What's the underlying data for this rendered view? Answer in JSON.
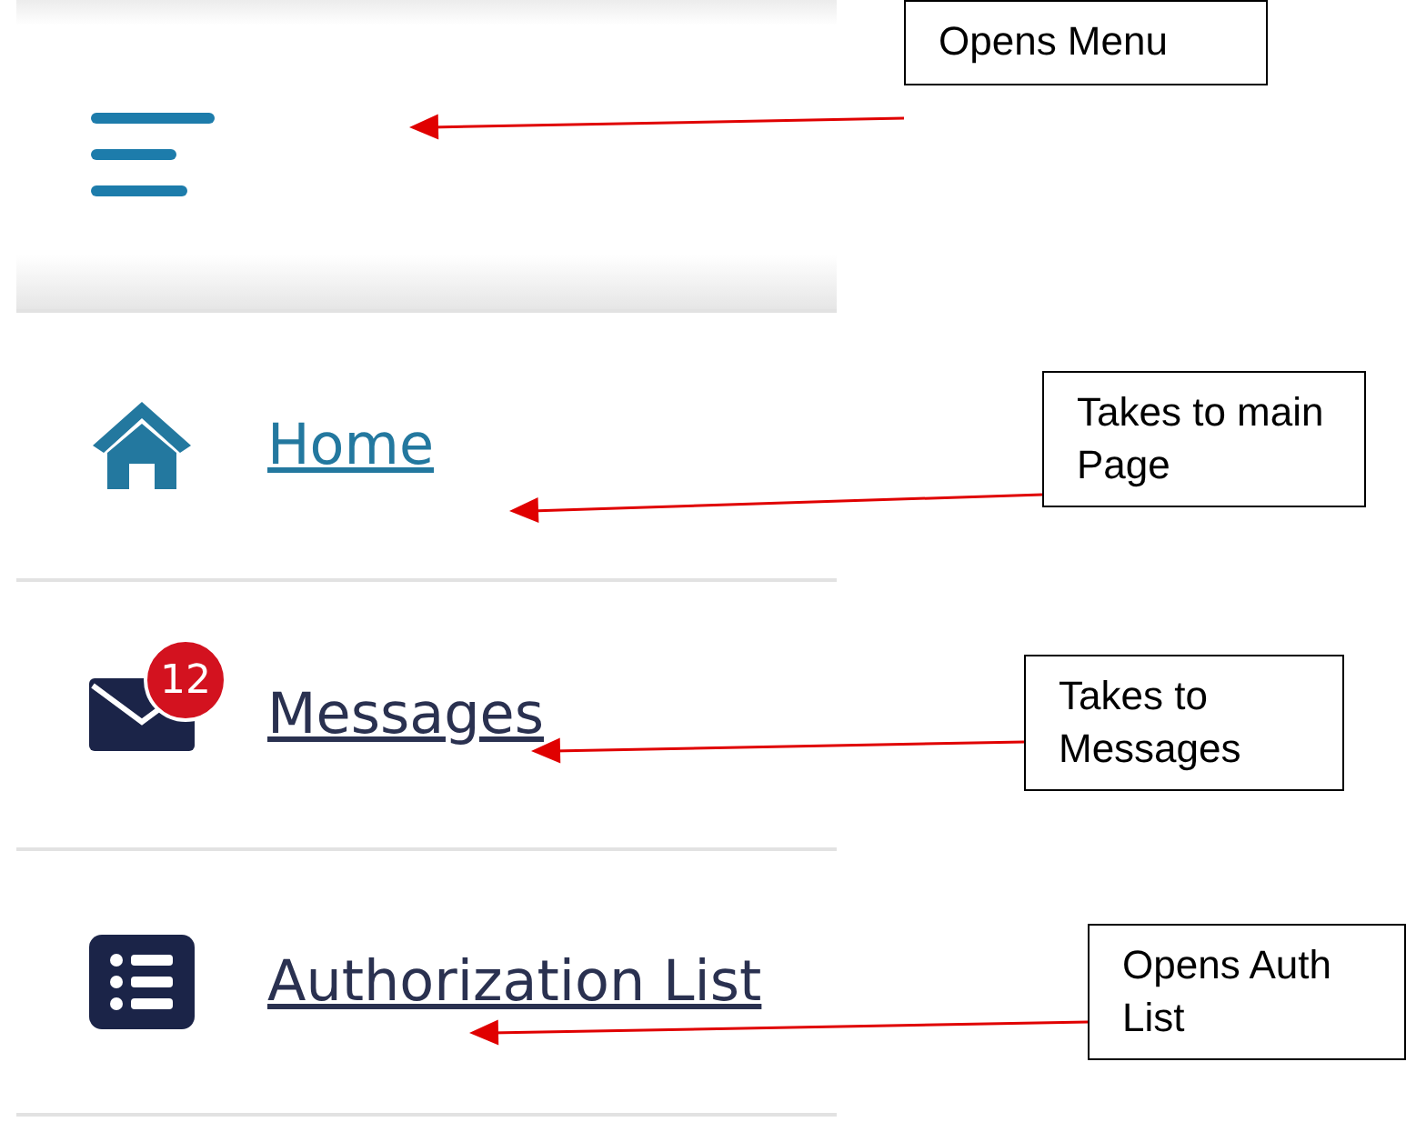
{
  "nav_items": [
    {
      "label": "Home",
      "selected": true,
      "kind": "home"
    },
    {
      "label": "Messages",
      "selected": false,
      "kind": "messages",
      "badge": "12"
    },
    {
      "label": "Authorization List",
      "selected": false,
      "kind": "list"
    }
  ],
  "annotations": [
    {
      "text": "Opens Menu"
    },
    {
      "text": "Takes to main Page"
    },
    {
      "text": "Takes to Messages"
    },
    {
      "text": "Opens Auth List"
    }
  ]
}
